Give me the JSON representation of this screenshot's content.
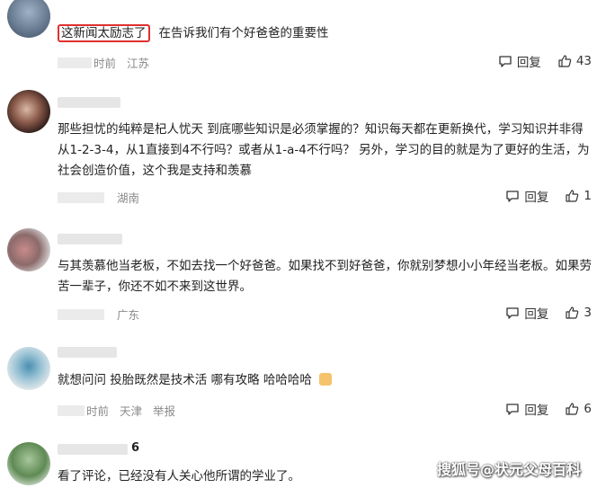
{
  "comments": [
    {
      "text_highlight": "这新闻太励志了",
      "text_rest": "在告诉我们有个好爸爸的重要性",
      "time": "时前",
      "location": "江苏",
      "reply_label": "回复",
      "likes": "43"
    },
    {
      "text": "那些担忧的纯粹是杞人忧天 到底哪些知识是必须掌握的？知识每天都在更新换代，学习知识并非得从1-2-3-4，从1直接到4不行吗？或者从1-a-4不行吗？ 另外，学习的目的就是为了更好的生活，为社会创造价值，这个我是支持和羡慕",
      "location": "湖南",
      "reply_label": "回复",
      "likes": "1"
    },
    {
      "text": "与其羡慕他当老板，不如去找一个好爸爸。如果找不到好爸爸，你就别梦想小小年经当老板。如果劳苦一辈子，你还不如不来到这世界。",
      "location": "广东",
      "reply_label": "回复",
      "likes": "3"
    },
    {
      "text": "就想问问 投胎既然是技术活 哪有攻略 哈哈哈哈",
      "time": "时前",
      "location": "天津",
      "report_label": "举报",
      "reply_label": "回复",
      "likes": "6"
    },
    {
      "name_suffix": "6",
      "text": "看了评论，已经没有人关心他所谓的学业了。"
    }
  ],
  "watermark": "搜狐号@状元父母百科",
  "colors": {
    "highlight_border": "#e03030",
    "meta_gray": "#8a8a8a"
  }
}
